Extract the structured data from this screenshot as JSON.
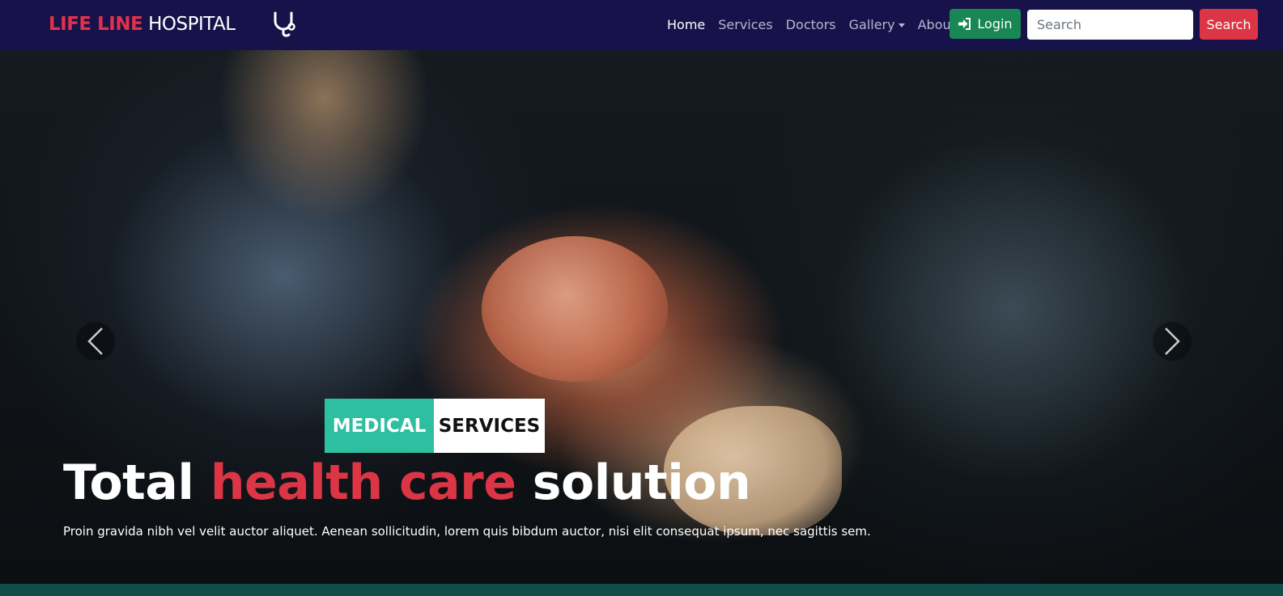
{
  "navbar": {
    "brand_red": "LIFE LINE",
    "brand_white": "HOSPITAL",
    "logo_icon": "stethoscope-icon",
    "links": [
      {
        "label": "Home",
        "active": true
      },
      {
        "label": "Services",
        "active": false
      },
      {
        "label": "Doctors",
        "active": false
      },
      {
        "label": "Gallery",
        "active": false,
        "dropdown": true
      },
      {
        "label": "About us",
        "active": false
      }
    ],
    "login_label": "Login",
    "login_icon": "sign-in-icon",
    "search_placeholder": "Search",
    "search_button_label": "Search"
  },
  "hero": {
    "badge_medical": "MEDICAL",
    "badge_services": "SERVICES",
    "headline_part1": "Total",
    "headline_part2": "health care",
    "headline_part3": "solution",
    "subtitle": "Proin gravida nibh vel velit auctor aliquet. Aenean sollicitudin, lorem quis bibdum auctor, nisi elit consequat ipsum, nec sagittis sem.",
    "prev_icon": "chevron-left-icon",
    "next_icon": "chevron-right-icon"
  },
  "colors": {
    "navbar_bg": "#17124a",
    "brand_red": "#e0324b",
    "login_green": "#198754",
    "search_red": "#dc3545",
    "badge_teal": "#2dbfa0",
    "headline_red": "#dc3545"
  }
}
